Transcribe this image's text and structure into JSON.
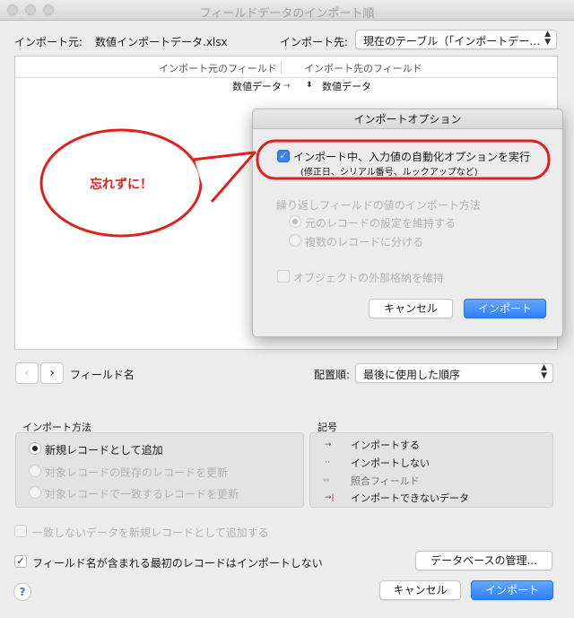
{
  "window": {
    "title": "フィールドデータのインポート順"
  },
  "source": {
    "label": "インポート元:",
    "filename": "数値インポートデータ.xlsx"
  },
  "target": {
    "label": "インポート先:",
    "value": "現在のテーブル（「インポートデー…"
  },
  "mapping": {
    "col_source": "インポート元のフィールド",
    "col_target": "インポート先のフィールド",
    "rows": [
      {
        "source": "数値データ",
        "target": "数値データ"
      }
    ]
  },
  "nav": {
    "prev": "‹",
    "next": "›",
    "field_name_label": "フィールド名"
  },
  "order": {
    "label": "配置順:",
    "value": "最後に使用した順序"
  },
  "import_method": {
    "title": "インポート方法",
    "options": [
      {
        "label": "新規レコードとして追加",
        "selected": true,
        "enabled": true
      },
      {
        "label": "対象レコードの既存のレコードを更新",
        "selected": false,
        "enabled": false
      },
      {
        "label": "対象レコードで一致するレコードを更新",
        "selected": false,
        "enabled": false
      }
    ]
  },
  "legend": {
    "title": "記号",
    "items": [
      {
        "icon": "import-arrow-icon",
        "label": "インポートする"
      },
      {
        "icon": "no-import-icon",
        "label": "インポートしない"
      },
      {
        "icon": "match-field-icon",
        "label": "照合フィールド"
      },
      {
        "icon": "cannot-import-icon",
        "label": "インポートできないデータ"
      }
    ]
  },
  "options": {
    "add_unmatched": {
      "label": "一致しないデータを新規レコードとして追加する",
      "checked": false,
      "enabled": false
    },
    "skip_first": {
      "label": "フィールド名が含まれる最初のレコードはインポートしない",
      "checked": true,
      "enabled": true
    }
  },
  "buttons": {
    "manage_db": "データベースの管理...",
    "cancel": "キャンセル",
    "import": "インポート",
    "help": "?"
  },
  "sheet": {
    "title": "インポートオプション",
    "auto_enter": {
      "label": "インポート中、入力値の自動化オプションを実行",
      "hint": "(修正日、シリアル番号、ルックアップなど)",
      "checked": true
    },
    "repeat_title": "繰り返しフィールドの値のインポート方法",
    "repeat_options": [
      {
        "label": "元のレコードの設定を維持する",
        "selected": true
      },
      {
        "label": "複数のレコードに分ける",
        "selected": false
      }
    ],
    "keep_external": {
      "label": "オブジェクトの外部格納を維持",
      "checked": false
    },
    "cancel": "キャンセル",
    "import": "インポート"
  },
  "annotation": {
    "text": "忘れずに！",
    "color": "#e0201d"
  },
  "colors": {
    "accent": "#3b83f5",
    "annotation": "#e0201d"
  }
}
